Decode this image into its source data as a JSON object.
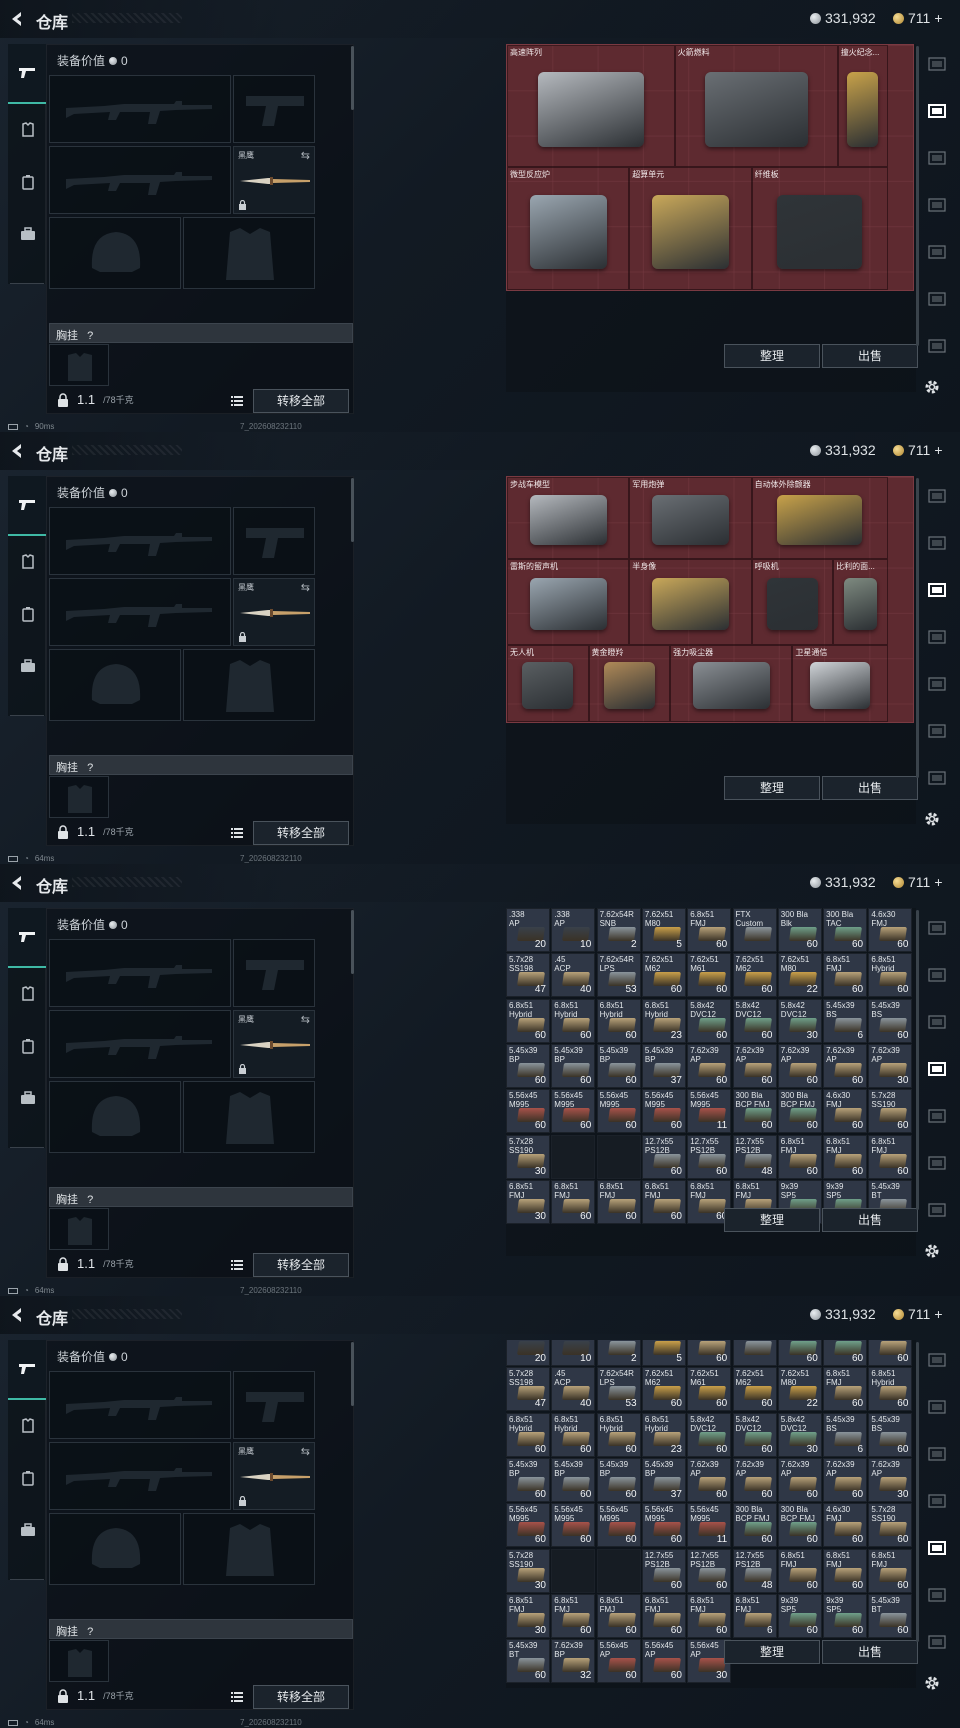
{
  "header": {
    "title": "仓库",
    "silver": "331,932",
    "gold": "711",
    "gold_suffix": "+"
  },
  "equipment": {
    "value_label": "装备价值",
    "value": "0",
    "melee_label": "黑鹰",
    "vest_label": "胸挂",
    "vest_help": "?",
    "weight": "1.1",
    "weight_max": "/78千克",
    "transfer_all": "转移全部"
  },
  "status": {
    "ping_panels": [
      "90ms",
      "64ms",
      "64ms",
      "64ms"
    ],
    "build": "7_202608232110"
  },
  "buttons": {
    "sort": "整理",
    "sell": "出售"
  },
  "stash1": [
    {
      "name": "高速阵列",
      "col": 0,
      "row": 0,
      "w": 3.7,
      "h": 2.7
    },
    {
      "name": "火箭燃料",
      "col": 3.7,
      "row": 0,
      "w": 3.6,
      "h": 2.7
    },
    {
      "name": "撞火纪念...",
      "col": 7.3,
      "row": 0,
      "w": 1.1,
      "h": 2.7
    },
    {
      "name": "微型反应炉",
      "col": 0,
      "row": 2.7,
      "w": 2.7,
      "h": 2.7
    },
    {
      "name": "超算单元",
      "col": 2.7,
      "row": 2.7,
      "w": 2.7,
      "h": 2.7
    },
    {
      "name": "纤维板",
      "col": 5.4,
      "row": 2.7,
      "w": 3.0,
      "h": 2.7
    }
  ],
  "stash2": [
    {
      "name": "步战车模型",
      "col": 0,
      "row": 0,
      "w": 2.7,
      "h": 1.8
    },
    {
      "name": "军用炮弹",
      "col": 2.7,
      "row": 0,
      "w": 2.7,
      "h": 1.8
    },
    {
      "name": "自动体外除颤器",
      "col": 5.4,
      "row": 0,
      "w": 3.0,
      "h": 1.8
    },
    {
      "name": "雷斯的留声机",
      "col": 0,
      "row": 1.8,
      "w": 2.7,
      "h": 1.9
    },
    {
      "name": "半身像",
      "col": 2.7,
      "row": 1.8,
      "w": 2.7,
      "h": 1.9
    },
    {
      "name": "呼吸机",
      "col": 5.4,
      "row": 1.8,
      "w": 1.8,
      "h": 1.9
    },
    {
      "name": "比利的面...",
      "col": 7.2,
      "row": 1.8,
      "w": 1.2,
      "h": 1.9
    },
    {
      "name": "无人机",
      "col": 0,
      "row": 3.7,
      "w": 1.8,
      "h": 1.7
    },
    {
      "name": "黄金瞪羚",
      "col": 1.8,
      "row": 3.7,
      "w": 1.8,
      "h": 1.7
    },
    {
      "name": "强力吸尘器",
      "col": 3.6,
      "row": 3.7,
      "w": 2.7,
      "h": 1.7
    },
    {
      "name": "卫星通信",
      "col": 6.3,
      "row": 3.7,
      "w": 2.1,
      "h": 1.7
    }
  ],
  "ammo": [
    [
      {
        "l": ".338\nAP",
        "c": "20",
        "k": "dark"
      },
      {
        "l": ".338\nAP",
        "c": "10",
        "k": "dark"
      },
      {
        "l": "7.62x54R\nSNB",
        "c": "2",
        "k": "gray"
      },
      {
        "l": "7.62x51\nM80",
        "c": "5",
        "k": "yel"
      },
      {
        "l": "6.8x51\nFMJ",
        "c": "60",
        "k": "tan"
      },
      {
        "l": "FTX\nCustom",
        "c": "",
        "k": "gray"
      },
      {
        "l": "300 Bla\nBlk",
        "c": "60",
        "k": "grn"
      },
      {
        "l": "300 Bla\nTAC",
        "c": "60",
        "k": "grn"
      },
      {
        "l": "4.6x30\nFMJ",
        "c": "60",
        "k": "tan"
      }
    ],
    [
      {
        "l": "5.7x28\nSS198",
        "c": "47",
        "k": "tan"
      },
      {
        "l": ".45\nACP",
        "c": "40",
        "k": "tan"
      },
      {
        "l": "7.62x54R\nLPS",
        "c": "53",
        "k": "gray"
      },
      {
        "l": "7.62x51\nM62",
        "c": "60",
        "k": "yel"
      },
      {
        "l": "7.62x51\nM61",
        "c": "60",
        "k": "yel"
      },
      {
        "l": "7.62x51\nM62",
        "c": "60",
        "k": "yel"
      },
      {
        "l": "7.62x51\nM80",
        "c": "22",
        "k": "yel"
      },
      {
        "l": "6.8x51\nFMJ",
        "c": "60",
        "k": "tan"
      },
      {
        "l": "6.8x51\nHybrid",
        "c": "60",
        "k": "tan"
      }
    ],
    [
      {
        "l": "6.8x51\nHybrid",
        "c": "60",
        "k": "tan"
      },
      {
        "l": "6.8x51\nHybrid",
        "c": "60",
        "k": "tan"
      },
      {
        "l": "6.8x51\nHybrid",
        "c": "60",
        "k": "tan"
      },
      {
        "l": "6.8x51\nHybrid",
        "c": "23",
        "k": "tan"
      },
      {
        "l": "5.8x42\nDVC12",
        "c": "60",
        "k": "grn"
      },
      {
        "l": "5.8x42\nDVC12",
        "c": "60",
        "k": "grn"
      },
      {
        "l": "5.8x42\nDVC12",
        "c": "30",
        "k": "grn"
      },
      {
        "l": "5.45x39\nBS",
        "c": "6",
        "k": "gray"
      },
      {
        "l": "5.45x39\nBS",
        "c": "60",
        "k": "gray"
      }
    ],
    [
      {
        "l": "5.45x39\nBP",
        "c": "60",
        "k": "gray"
      },
      {
        "l": "5.45x39\nBP",
        "c": "60",
        "k": "gray"
      },
      {
        "l": "5.45x39\nBP",
        "c": "60",
        "k": "gray"
      },
      {
        "l": "5.45x39\nBP",
        "c": "37",
        "k": "gray"
      },
      {
        "l": "7.62x39\nAP",
        "c": "60",
        "k": "tan"
      },
      {
        "l": "7.62x39\nAP",
        "c": "60",
        "k": "tan"
      },
      {
        "l": "7.62x39\nAP",
        "c": "60",
        "k": "tan"
      },
      {
        "l": "7.62x39\nAP",
        "c": "60",
        "k": "tan"
      },
      {
        "l": "7.62x39\nAP",
        "c": "30",
        "k": "tan"
      }
    ],
    [
      {
        "l": "5.56x45\nM995",
        "c": "60",
        "k": "red"
      },
      {
        "l": "5.56x45\nM995",
        "c": "60",
        "k": "red"
      },
      {
        "l": "5.56x45\nM995",
        "c": "60",
        "k": "red"
      },
      {
        "l": "5.56x45\nM995",
        "c": "60",
        "k": "red"
      },
      {
        "l": "5.56x45\nM995",
        "c": "11",
        "k": "red"
      },
      {
        "l": "300 Bla\nBCP FMJ",
        "c": "60",
        "k": "grn"
      },
      {
        "l": "300 Bla\nBCP FMJ",
        "c": "60",
        "k": "grn"
      },
      {
        "l": "4.6x30\nFMJ",
        "c": "60",
        "k": "tan"
      },
      {
        "l": "5.7x28\nSS190",
        "c": "60",
        "k": "tan"
      }
    ],
    [
      {
        "l": "5.7x28\nSS190",
        "c": "30",
        "k": "tan"
      },
      {
        "l": "",
        "c": "",
        "k": "empty"
      },
      {
        "l": "",
        "c": "",
        "k": "empty"
      },
      {
        "l": "12.7x55\nPS12B",
        "c": "60",
        "k": "gray"
      },
      {
        "l": "12.7x55\nPS12B",
        "c": "60",
        "k": "gray"
      },
      {
        "l": "12.7x55\nPS12B",
        "c": "48",
        "k": "gray"
      },
      {
        "l": "6.8x51\nFMJ",
        "c": "60",
        "k": "tan"
      },
      {
        "l": "6.8x51\nFMJ",
        "c": "60",
        "k": "tan"
      },
      {
        "l": "6.8x51\nFMJ",
        "c": "60",
        "k": "tan"
      }
    ],
    [
      {
        "l": "6.8x51\nFMJ",
        "c": "30",
        "k": "tan"
      },
      {
        "l": "6.8x51\nFMJ",
        "c": "60",
        "k": "tan"
      },
      {
        "l": "6.8x51\nFMJ",
        "c": "60",
        "k": "tan"
      },
      {
        "l": "6.8x51\nFMJ",
        "c": "60",
        "k": "tan"
      },
      {
        "l": "6.8x51\nFMJ",
        "c": "60",
        "k": "tan"
      },
      {
        "l": "6.8x51\nFMJ",
        "c": "6",
        "k": "tan"
      },
      {
        "l": "9x39\nSP5",
        "c": "60",
        "k": "grn"
      },
      {
        "l": "9x39\nSP5",
        "c": "60",
        "k": "grn"
      },
      {
        "l": "5.45x39\nBT",
        "c": "60",
        "k": "gray"
      }
    ],
    [
      {
        "l": "5.45x39\nBT",
        "c": "60",
        "k": "gray"
      },
      {
        "l": "7.62x39\nBP",
        "c": "32",
        "k": "tan"
      },
      {
        "l": "5.56x45\nAP",
        "c": "60",
        "k": "red"
      },
      {
        "l": "5.56x45\nAP",
        "c": "60",
        "k": "red"
      },
      {
        "l": "5.56x45\nAP",
        "c": "30",
        "k": "red"
      }
    ]
  ],
  "colors": {
    "accent": "#3fb9a5",
    "stash_red": "#5e2a30"
  }
}
